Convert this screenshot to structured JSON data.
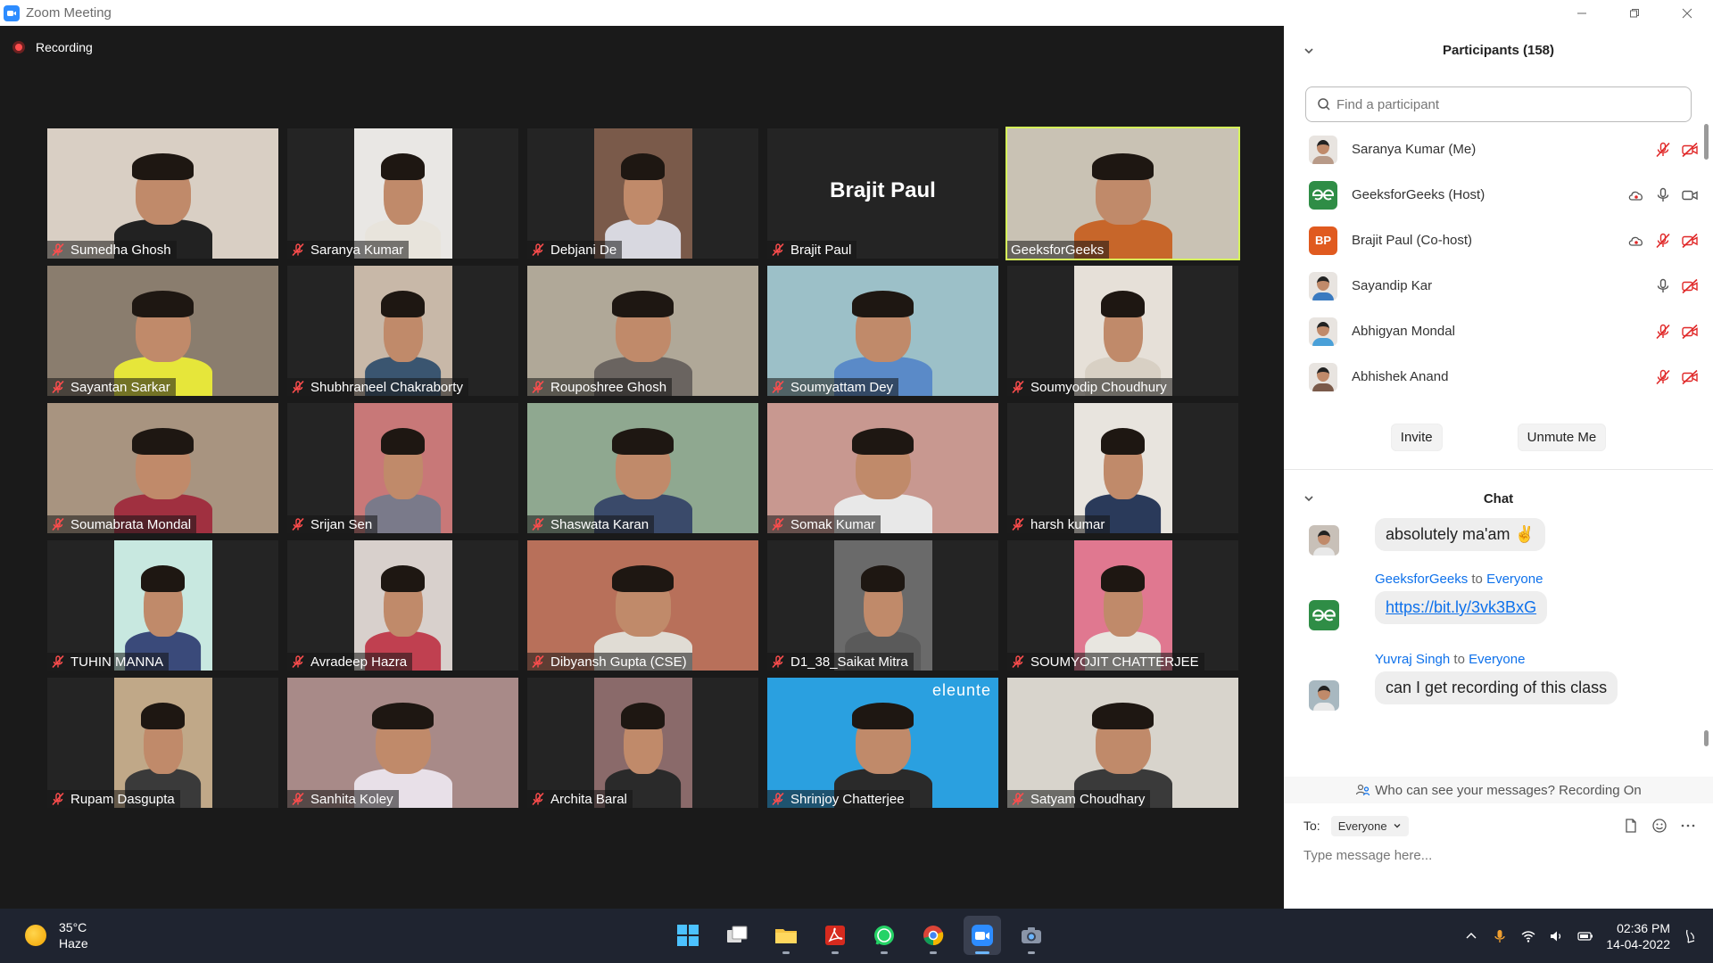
{
  "window": {
    "title": "Zoom Meeting"
  },
  "meeting": {
    "recording_label": "Recording",
    "tiles": [
      {
        "name": "Sumedha Ghosh",
        "bg": "#d9cfc4",
        "shirt": "#222222",
        "style": "full"
      },
      {
        "name": "Saranya Kumar",
        "bg": "#e9e7e4",
        "shirt": "#e8e4dc",
        "style": "narrow"
      },
      {
        "name": "Debjani De",
        "bg": "#7a5a4a",
        "shirt": "#d8d8e0",
        "style": "narrow"
      },
      {
        "name": "Brajit Paul",
        "bg": "#242424",
        "shirt": "",
        "style": "name",
        "display_name": "Brajit Paul"
      },
      {
        "name": "GeeksforGeeks",
        "bg": "#c9c2b4",
        "shirt": "#c7662a",
        "style": "full",
        "speaking": true
      },
      {
        "name": "Sayantan Sarkar",
        "bg": "#8a7d6e",
        "shirt": "#e6e63a",
        "style": "full"
      },
      {
        "name": "Shubhraneel Chakraborty",
        "bg": "#c8b8a8",
        "shirt": "#3a5570",
        "style": "narrow"
      },
      {
        "name": "Rouposhree Ghosh",
        "bg": "#b0a898",
        "shirt": "#6a6460",
        "style": "full"
      },
      {
        "name": "Soumyattam Dey",
        "bg": "#9cc0c8",
        "shirt": "#5a8ac8",
        "style": "full"
      },
      {
        "name": "Soumyodip Choudhury",
        "bg": "#e6e0d8",
        "shirt": "#d8d0c4",
        "style": "narrow"
      },
      {
        "name": "Soumabrata Mondal",
        "bg": "#a89480",
        "shirt": "#a03040",
        "style": "full"
      },
      {
        "name": "Srijan Sen",
        "bg": "#c87878",
        "shirt": "#7a7a8a",
        "style": "narrow"
      },
      {
        "name": "Shaswata Karan",
        "bg": "#8fa890",
        "shirt": "#3a4a6a",
        "style": "full"
      },
      {
        "name": "Somak Kumar",
        "bg": "#c89890",
        "shirt": "#e8e8e8",
        "style": "full"
      },
      {
        "name": "harsh kumar",
        "bg": "#e8e4de",
        "shirt": "#2a3a5a",
        "style": "narrow"
      },
      {
        "name": "TUHIN MANNA",
        "bg": "#c8e8e0",
        "shirt": "#3a4a7a",
        "style": "narrow"
      },
      {
        "name": "Avradeep Hazra",
        "bg": "#d8d0cc",
        "shirt": "#c04050",
        "style": "narrow"
      },
      {
        "name": "Dibyansh Gupta (CSE)",
        "bg": "#b8705a",
        "shirt": "#e0dcd4",
        "style": "full"
      },
      {
        "name": "D1_38_Saikat Mitra",
        "bg": "#6a6a6a",
        "shirt": "#5a5a5a",
        "style": "narrow"
      },
      {
        "name": "SOUMYOJIT CHATTERJEE",
        "bg": "#e07890",
        "shirt": "#e8e6e0",
        "style": "narrow"
      },
      {
        "name": "Rupam Dasgupta",
        "bg": "#c0a888",
        "shirt": "#3a3a3a",
        "style": "narrow"
      },
      {
        "name": "Sanhita Koley",
        "bg": "#a88a88",
        "shirt": "#e8e0e8",
        "style": "full"
      },
      {
        "name": "Archita Baral",
        "bg": "#8a6a6a",
        "shirt": "#2a2a2a",
        "style": "narrow"
      },
      {
        "name": "Shrinjoy Chatterjee",
        "bg": "#2aa0e0",
        "shirt": "#2a2a2a",
        "style": "full",
        "overlay_text": "eleunte"
      },
      {
        "name": "Satyam Choudhary",
        "bg": "#d8d4cc",
        "shirt": "#3a3a3a",
        "style": "full"
      }
    ]
  },
  "participants": {
    "title": "Participants (158)",
    "search_placeholder": "Find a participant",
    "list": [
      {
        "name": "Saranya Kumar (Me)",
        "avatar": "photo",
        "avatar_color": "#b89a88",
        "icons": [
          "mic-muted-icon",
          "video-off-icon"
        ]
      },
      {
        "name": "GeeksforGeeks (Host)",
        "avatar": "gfg",
        "avatar_color": "#2f8d46",
        "icons": [
          "recording-cloud-icon",
          "mic-icon",
          "video-icon"
        ]
      },
      {
        "name": "Brajit Paul (Co-host)",
        "avatar": "initials",
        "avatar_text": "BP",
        "avatar_color": "#e05a1f",
        "icons": [
          "recording-cloud-icon",
          "mic-muted-icon",
          "video-off-icon"
        ]
      },
      {
        "name": "Sayandip Kar",
        "avatar": "photo",
        "avatar_color": "#3a7ac0",
        "icons": [
          "mic-icon",
          "video-off-icon"
        ]
      },
      {
        "name": "Abhigyan Mondal",
        "avatar": "photo",
        "avatar_color": "#4aa0d8",
        "icons": [
          "mic-muted-icon",
          "video-off-icon"
        ]
      },
      {
        "name": "Abhishek Anand",
        "avatar": "photo",
        "avatar_color": "#7a5a4a",
        "icons": [
          "mic-muted-icon",
          "video-off-icon"
        ]
      }
    ],
    "invite_label": "Invite",
    "unmute_label": "Unmute Me"
  },
  "chat": {
    "title": "Chat",
    "messages": [
      {
        "sender": "",
        "to": "",
        "text": "absolutely ma'am ✌",
        "avatar": "photo",
        "avatar_color": "#c8c0b8",
        "link": false
      },
      {
        "sender": "GeeksforGeeks",
        "to_word": "to",
        "to": "Everyone",
        "text": "https://bit.ly/3vk3BxG",
        "avatar": "gfg",
        "avatar_color": "#2f8d46",
        "link": true
      },
      {
        "sender": "Yuvraj Singh",
        "to_word": "to",
        "to": "Everyone",
        "text": "can I get recording of this class",
        "avatar": "photo",
        "avatar_color": "#a8b8c0",
        "link": false
      }
    ],
    "visibility_note": "Who can see your messages? Recording On",
    "to_label": "To:",
    "to_value": "Everyone",
    "input_placeholder": "Type message here..."
  },
  "taskbar": {
    "temperature": "35°C",
    "weather": "Haze",
    "time": "02:36 PM",
    "date": "14-04-2022",
    "apps": [
      "windows-start-icon",
      "task-view-icon",
      "file-explorer-icon",
      "acrobat-icon",
      "whatsapp-icon",
      "chrome-icon",
      "zoom-icon",
      "camera-icon"
    ]
  }
}
